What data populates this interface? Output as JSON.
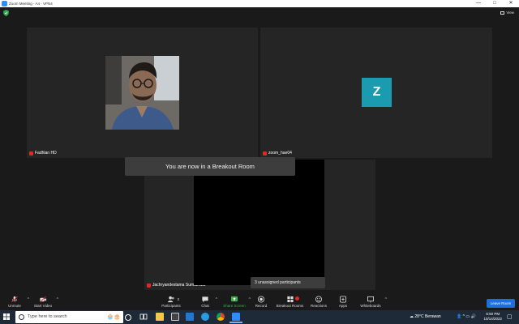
{
  "window": {
    "title": "Zoom Meeting - A4 - VPN4"
  },
  "header": {
    "view_label": "View"
  },
  "participants": [
    {
      "name": "Fadhlan HD"
    },
    {
      "name": "zoom_hae04",
      "initial": "Z",
      "avatar_color": "#1a9bb0"
    },
    {
      "name": "Jachryandestama Sumabrata"
    }
  ],
  "breakout_notice": "You are now in a Breakout Room",
  "unassigned_notice": "3 unassigned participants",
  "toolbar": {
    "unmute": "Unmute",
    "start_video": "Start Video",
    "participants": "Participants",
    "participants_count": "3",
    "chat": "Chat",
    "share_screen": "Share Screen",
    "record": "Record",
    "breakout_rooms": "Breakout Rooms",
    "reactions": "Reactions",
    "apps": "Apps",
    "whiteboards": "Whiteboards",
    "leave_room": "Leave Room"
  },
  "taskbar": {
    "search_placeholder": "Type here to search",
    "weather": "28°C  Berawan",
    "time": "6:50 PM",
    "date": "10/14/2022"
  },
  "colors": {
    "accent_green": "#36b34a",
    "leave_blue": "#1e6fd9",
    "muted_red": "#e02828"
  }
}
